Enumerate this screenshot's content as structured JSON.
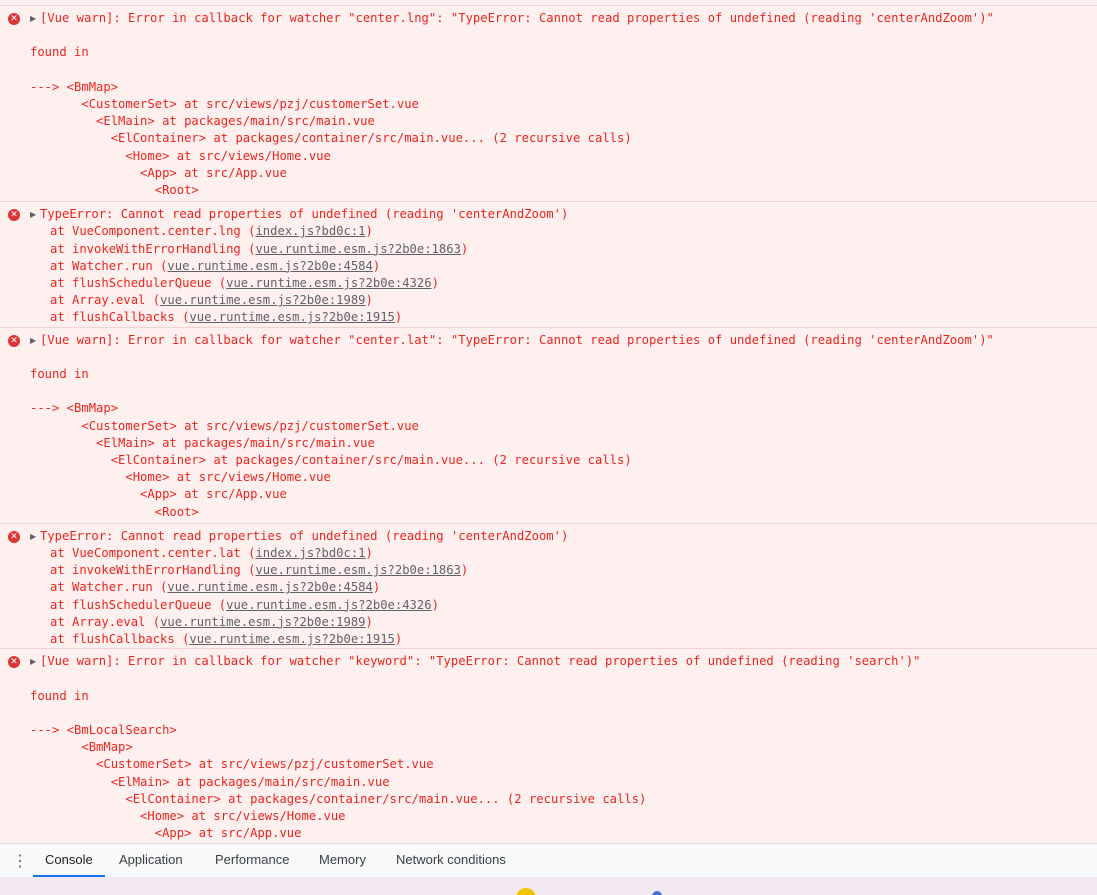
{
  "console": {
    "messages": [
      {
        "kind": "warn",
        "lines": [
          "[Vue warn]: Error in callback for watcher \"center.lng\": \"TypeError: Cannot read properties of undefined (reading 'centerAndZoom')\"",
          "",
          "found in",
          "",
          "---> <BmMap>",
          "       <CustomerSet> at src/views/pzj/customerSet.vue",
          "         <ElMain> at packages/main/src/main.vue",
          "           <ElContainer> at packages/container/src/main.vue... (2 recursive calls)",
          "             <Home> at src/views/Home.vue",
          "               <App> at src/App.vue",
          "                 <Root>"
        ]
      },
      {
        "kind": "trace",
        "header": "TypeError: Cannot read properties of undefined (reading 'centerAndZoom')",
        "frames": [
          {
            "prefix": "at VueComponent.center.lng (",
            "link": "index.js?bd0c:1",
            "suffix": ")"
          },
          {
            "prefix": "at invokeWithErrorHandling (",
            "link": "vue.runtime.esm.js?2b0e:1863",
            "suffix": ")"
          },
          {
            "prefix": "at Watcher.run (",
            "link": "vue.runtime.esm.js?2b0e:4584",
            "suffix": ")"
          },
          {
            "prefix": "at flushSchedulerQueue (",
            "link": "vue.runtime.esm.js?2b0e:4326",
            "suffix": ")"
          },
          {
            "prefix": "at Array.eval (",
            "link": "vue.runtime.esm.js?2b0e:1989",
            "suffix": ")"
          },
          {
            "prefix": "at flushCallbacks (",
            "link": "vue.runtime.esm.js?2b0e:1915",
            "suffix": ")"
          }
        ]
      },
      {
        "kind": "warn",
        "lines": [
          "[Vue warn]: Error in callback for watcher \"center.lat\": \"TypeError: Cannot read properties of undefined (reading 'centerAndZoom')\"",
          "",
          "found in",
          "",
          "---> <BmMap>",
          "       <CustomerSet> at src/views/pzj/customerSet.vue",
          "         <ElMain> at packages/main/src/main.vue",
          "           <ElContainer> at packages/container/src/main.vue... (2 recursive calls)",
          "             <Home> at src/views/Home.vue",
          "               <App> at src/App.vue",
          "                 <Root>"
        ]
      },
      {
        "kind": "trace",
        "header": "TypeError: Cannot read properties of undefined (reading 'centerAndZoom')",
        "frames": [
          {
            "prefix": "at VueComponent.center.lat (",
            "link": "index.js?bd0c:1",
            "suffix": ")"
          },
          {
            "prefix": "at invokeWithErrorHandling (",
            "link": "vue.runtime.esm.js?2b0e:1863",
            "suffix": ")"
          },
          {
            "prefix": "at Watcher.run (",
            "link": "vue.runtime.esm.js?2b0e:4584",
            "suffix": ")"
          },
          {
            "prefix": "at flushSchedulerQueue (",
            "link": "vue.runtime.esm.js?2b0e:4326",
            "suffix": ")"
          },
          {
            "prefix": "at Array.eval (",
            "link": "vue.runtime.esm.js?2b0e:1989",
            "suffix": ")"
          },
          {
            "prefix": "at flushCallbacks (",
            "link": "vue.runtime.esm.js?2b0e:1915",
            "suffix": ")"
          }
        ]
      },
      {
        "kind": "warn",
        "lines": [
          "[Vue warn]: Error in callback for watcher \"keyword\": \"TypeError: Cannot read properties of undefined (reading 'search')\"",
          "",
          "found in",
          "",
          "---> <BmLocalSearch>",
          "       <BmMap>",
          "         <CustomerSet> at src/views/pzj/customerSet.vue",
          "           <ElMain> at packages/main/src/main.vue",
          "             <ElContainer> at packages/container/src/main.vue... (2 recursive calls)",
          "               <Home> at src/views/Home.vue",
          "                 <App> at src/App.vue"
        ]
      }
    ],
    "error_icon": "error-circle-icon",
    "expand_icon": "expand-triangle-icon"
  },
  "drawer": {
    "menu_icon": "more-vert-icon",
    "tabs": [
      {
        "label": "Console",
        "active": true
      },
      {
        "label": "Application",
        "active": false
      },
      {
        "label": "Performance",
        "active": false
      },
      {
        "label": "Memory",
        "active": false
      },
      {
        "label": "Network conditions",
        "active": false
      }
    ]
  },
  "colors": {
    "error_text": "#e8261e",
    "error_bg": "#fff0f0",
    "tab_accent": "#1a73e8"
  }
}
